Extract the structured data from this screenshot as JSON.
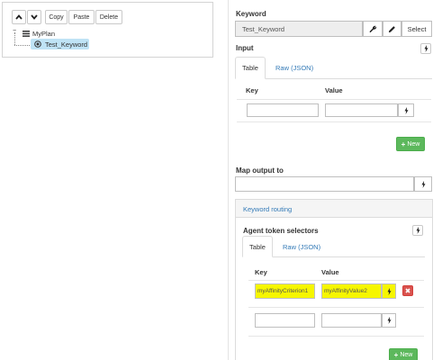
{
  "toolbar": {
    "copy_label": "Copy",
    "paste_label": "Paste",
    "delete_label": "Delete"
  },
  "tree": {
    "toggle_symbol": "−",
    "root_label": "MyPlan",
    "child_label": "Test_Keyword"
  },
  "keyword": {
    "heading": "Keyword",
    "value": "Test_Keyword",
    "select_label": "Select"
  },
  "input": {
    "heading": "Input",
    "tabs": [
      "Table",
      "Raw (JSON)"
    ],
    "col_key": "Key",
    "col_value": "Value",
    "new_label": "New"
  },
  "map_output": {
    "heading": "Map output to"
  },
  "routing": {
    "title": "Keyword routing",
    "selectors_heading": "Agent token selectors",
    "tabs": [
      "Table",
      "Raw (JSON)"
    ],
    "col_key": "Key",
    "col_value": "Value",
    "rows": [
      {
        "key": "myAffinityCriterion1",
        "value": "myAffinityValue2"
      }
    ],
    "new_label": "New"
  },
  "colors": {
    "accent": "#337ab7",
    "success": "#5cb85c",
    "danger": "#d9534f",
    "highlight": "#f6f600",
    "selection": "#bfe3f5"
  }
}
